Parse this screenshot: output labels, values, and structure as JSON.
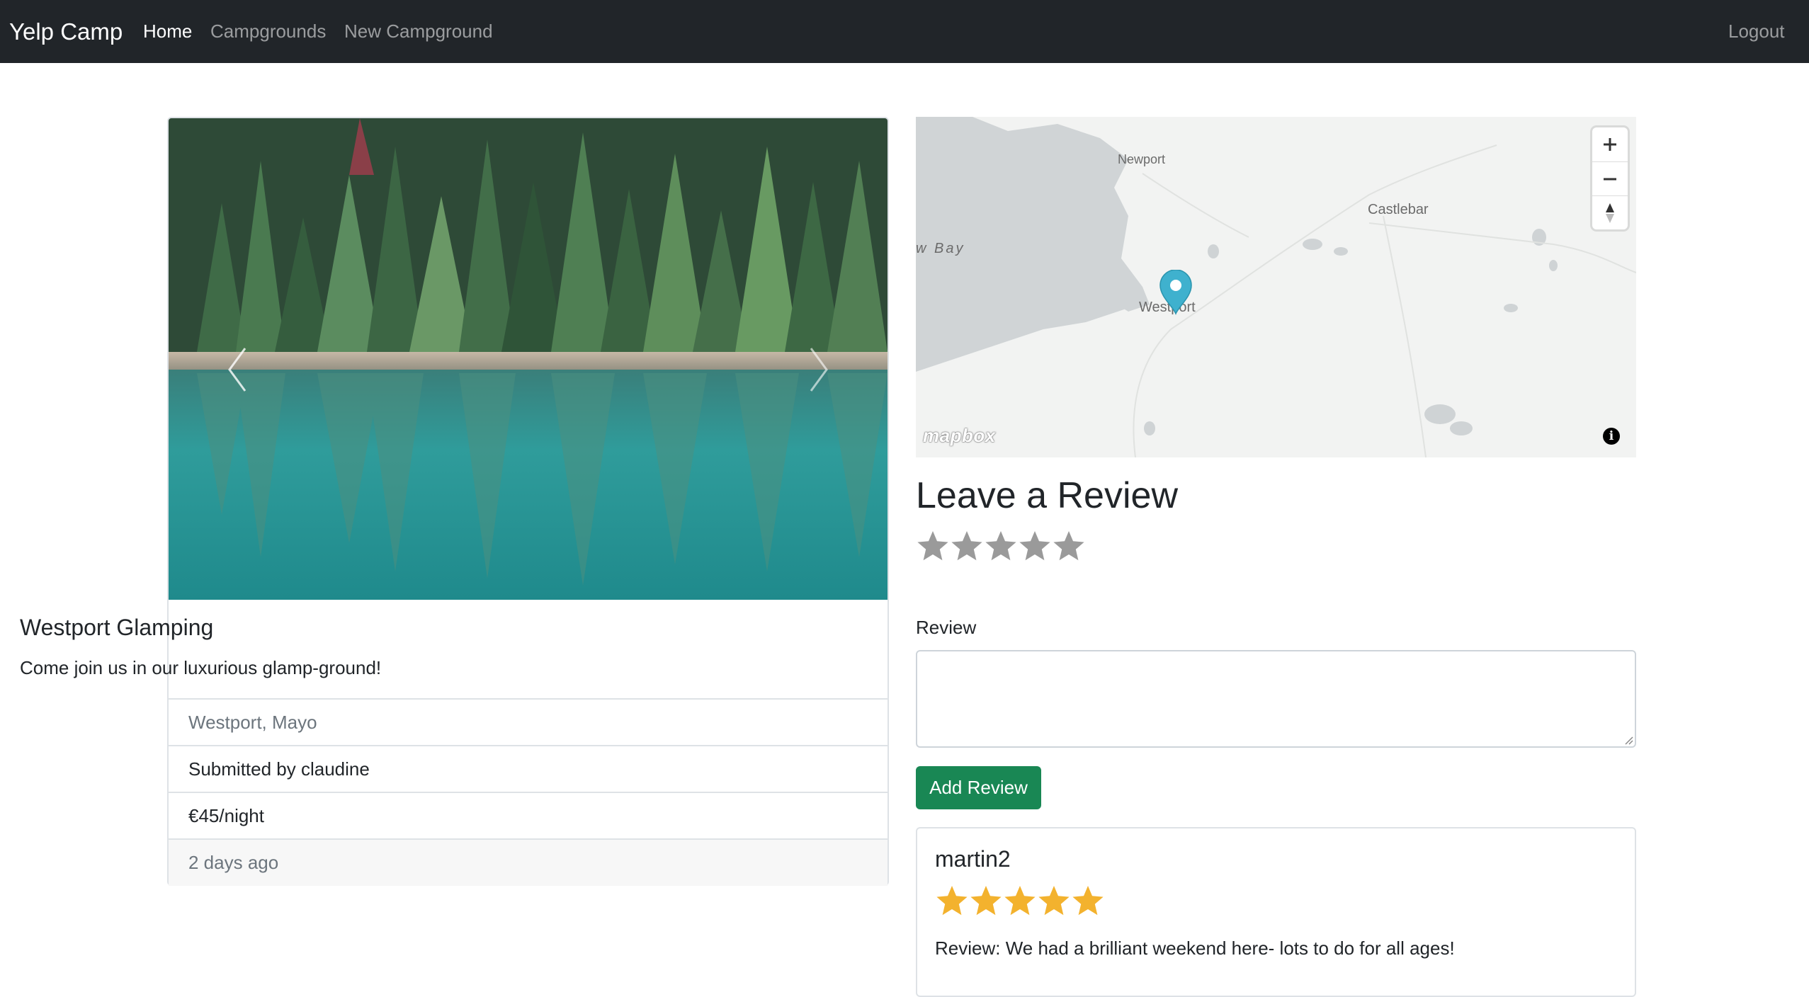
{
  "navbar": {
    "brand": "Yelp Camp",
    "links": [
      {
        "label": "Home",
        "active": true
      },
      {
        "label": "Campgrounds",
        "active": false
      },
      {
        "label": "New Campground",
        "active": false
      }
    ],
    "logout": "Logout"
  },
  "campground": {
    "title": "Westport Glamping",
    "description": "Come join us in our luxurious glamp-ground!",
    "location": "Westport, Mayo",
    "submitted_by": "Submitted by claudine",
    "price": "€45/night",
    "posted": "2 days ago",
    "image_alt": "forest lake reflection"
  },
  "map": {
    "labels": [
      "Newport",
      "Castlebar",
      "w Bay",
      "Westport"
    ],
    "logo": "mapbox",
    "info": "i",
    "marker_color": "#3fb1ce",
    "controls": [
      "zoom-in",
      "zoom-out",
      "compass"
    ]
  },
  "review_form": {
    "heading": "Leave a Review",
    "rating": 0,
    "max_rating": 5,
    "label": "Review",
    "value": "",
    "submit": "Add Review"
  },
  "reviews": [
    {
      "author": "martin2",
      "rating": 5,
      "text": "Review: We had a brilliant weekend here- lots to do for all ages!"
    }
  ],
  "colors": {
    "navbar_bg": "#212529",
    "button_green": "#198754",
    "star_filled": "#f3b22e",
    "star_empty": "#9a9a9a"
  }
}
